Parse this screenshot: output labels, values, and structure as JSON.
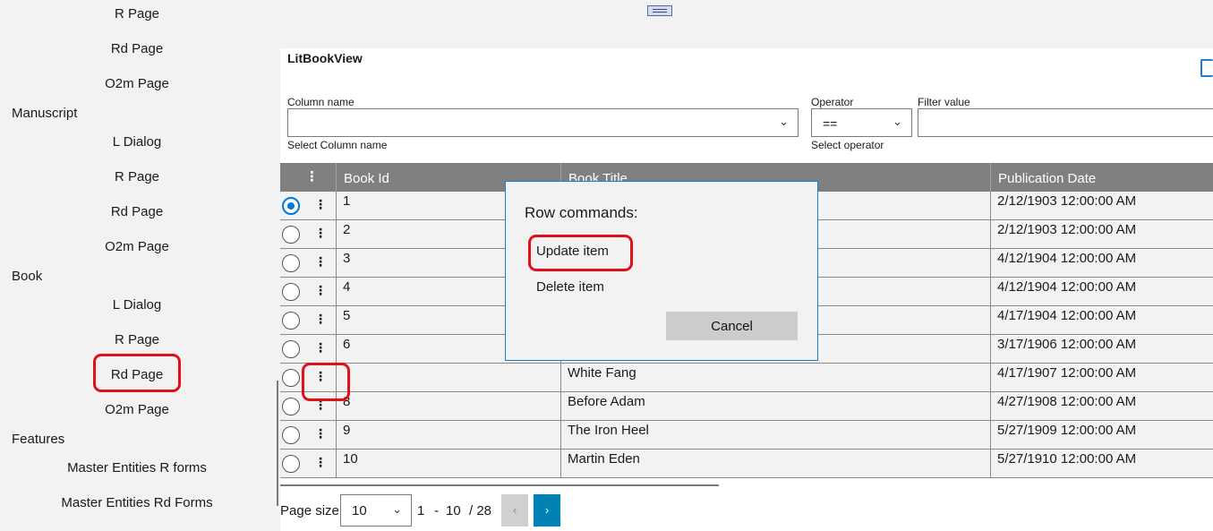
{
  "sidebar": {
    "items": [
      {
        "label": "R Page",
        "type": "item"
      },
      {
        "label": "Rd Page",
        "type": "item"
      },
      {
        "label": "O2m Page",
        "type": "item"
      },
      {
        "label": "Manuscript",
        "type": "group"
      },
      {
        "label": "L Dialog",
        "type": "item"
      },
      {
        "label": "R Page",
        "type": "item"
      },
      {
        "label": "Rd Page",
        "type": "item"
      },
      {
        "label": "O2m Page",
        "type": "item"
      },
      {
        "label": "Book",
        "type": "group"
      },
      {
        "label": "L Dialog",
        "type": "item"
      },
      {
        "label": "R Page",
        "type": "item"
      },
      {
        "label": "Rd Page",
        "type": "item"
      },
      {
        "label": "O2m Page",
        "type": "item"
      },
      {
        "label": "Features",
        "type": "group"
      },
      {
        "label": "Master Entities R forms",
        "type": "item"
      },
      {
        "label": "Master Entities Rd Forms",
        "type": "item"
      }
    ]
  },
  "view": {
    "title": "LitBookView",
    "filter": {
      "column_label": "Column name",
      "column_value": "",
      "column_hint": "Select Column name",
      "operator_label": "Operator",
      "operator_value": "==",
      "operator_hint": "Select operator",
      "value_label": "Filter value",
      "value_value": ""
    }
  },
  "grid": {
    "menu_glyph": "⋮",
    "columns": [
      "Book Id",
      "Book Title",
      "Publication Date"
    ],
    "rows": [
      {
        "id": "1",
        "title": "",
        "date": "2/12/1903 12:00:00 AM",
        "selected": true
      },
      {
        "id": "2",
        "title": "",
        "date": "2/12/1903 12:00:00 AM",
        "selected": false
      },
      {
        "id": "3",
        "title": "",
        "date": "4/12/1904 12:00:00 AM",
        "selected": false
      },
      {
        "id": "4",
        "title": "",
        "date": "4/12/1904 12:00:00 AM",
        "selected": false
      },
      {
        "id": "5",
        "title": "",
        "date": "4/17/1904 12:00:00 AM",
        "selected": false
      },
      {
        "id": "6",
        "title": "",
        "date": "3/17/1906 12:00:00 AM",
        "selected": false
      },
      {
        "id": "",
        "title": "White Fang",
        "date": "4/17/1907 12:00:00 AM",
        "selected": false
      },
      {
        "id": "8",
        "title": "Before Adam",
        "date": "4/27/1908 12:00:00 AM",
        "selected": false
      },
      {
        "id": "9",
        "title": "The Iron Heel",
        "date": "5/27/1909 12:00:00 AM",
        "selected": false
      },
      {
        "id": "10",
        "title": "Martin Eden",
        "date": "5/27/1910 12:00:00 AM",
        "selected": false
      }
    ]
  },
  "pager": {
    "page_size_label": "Page size",
    "page_size_value": "10",
    "range_start": "1",
    "range_sep": "-",
    "range_end": "10",
    "total": "/ 28",
    "prev_glyph": "‹",
    "next_glyph": "›"
  },
  "dialog": {
    "title": "Row commands:",
    "update_label": "Update item",
    "delete_label": "Delete item",
    "cancel_label": "Cancel"
  },
  "colors": {
    "accent": "#0078d4",
    "header_bg": "#808080",
    "highlight": "#e0101a",
    "next_button": "#0082b4"
  }
}
